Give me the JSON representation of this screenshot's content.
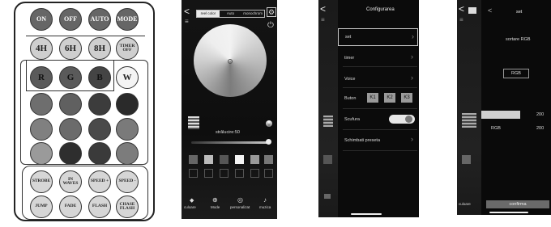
{
  "remote": {
    "row1": [
      "ON",
      "OFF",
      "AUTO",
      "MODE"
    ],
    "row2": [
      "4H",
      "6H",
      "8H",
      "TIMER OFF"
    ],
    "row3": [
      "R",
      "G",
      "B",
      "W"
    ],
    "row7": [
      "STROBE",
      "IN WAVES",
      "SPEED +",
      "SPEED -"
    ],
    "row8": [
      "JUMP",
      "FADE",
      "FLASH",
      "CHASE FLASH"
    ]
  },
  "phone1": {
    "tabs": [
      "reel color",
      "Auto",
      "monochrom"
    ],
    "brightness_label": "strălucire:50",
    "nav": [
      "culoare",
      "Mode",
      "personalizat",
      "muzica"
    ]
  },
  "phone2": {
    "title": "Configurarea",
    "menu": [
      "set",
      "timer",
      "Voice",
      "Buton",
      "Scufura",
      "Schimbati preseta"
    ],
    "keys": [
      "K1",
      "K2",
      "K3"
    ]
  },
  "phone3": {
    "title": "set",
    "subtitle": "sortare RGB",
    "picker_selected": "RGB",
    "row_label": "RGB",
    "value1": "200",
    "value2": "200",
    "confirm": "confirma",
    "nav": "culoare"
  }
}
